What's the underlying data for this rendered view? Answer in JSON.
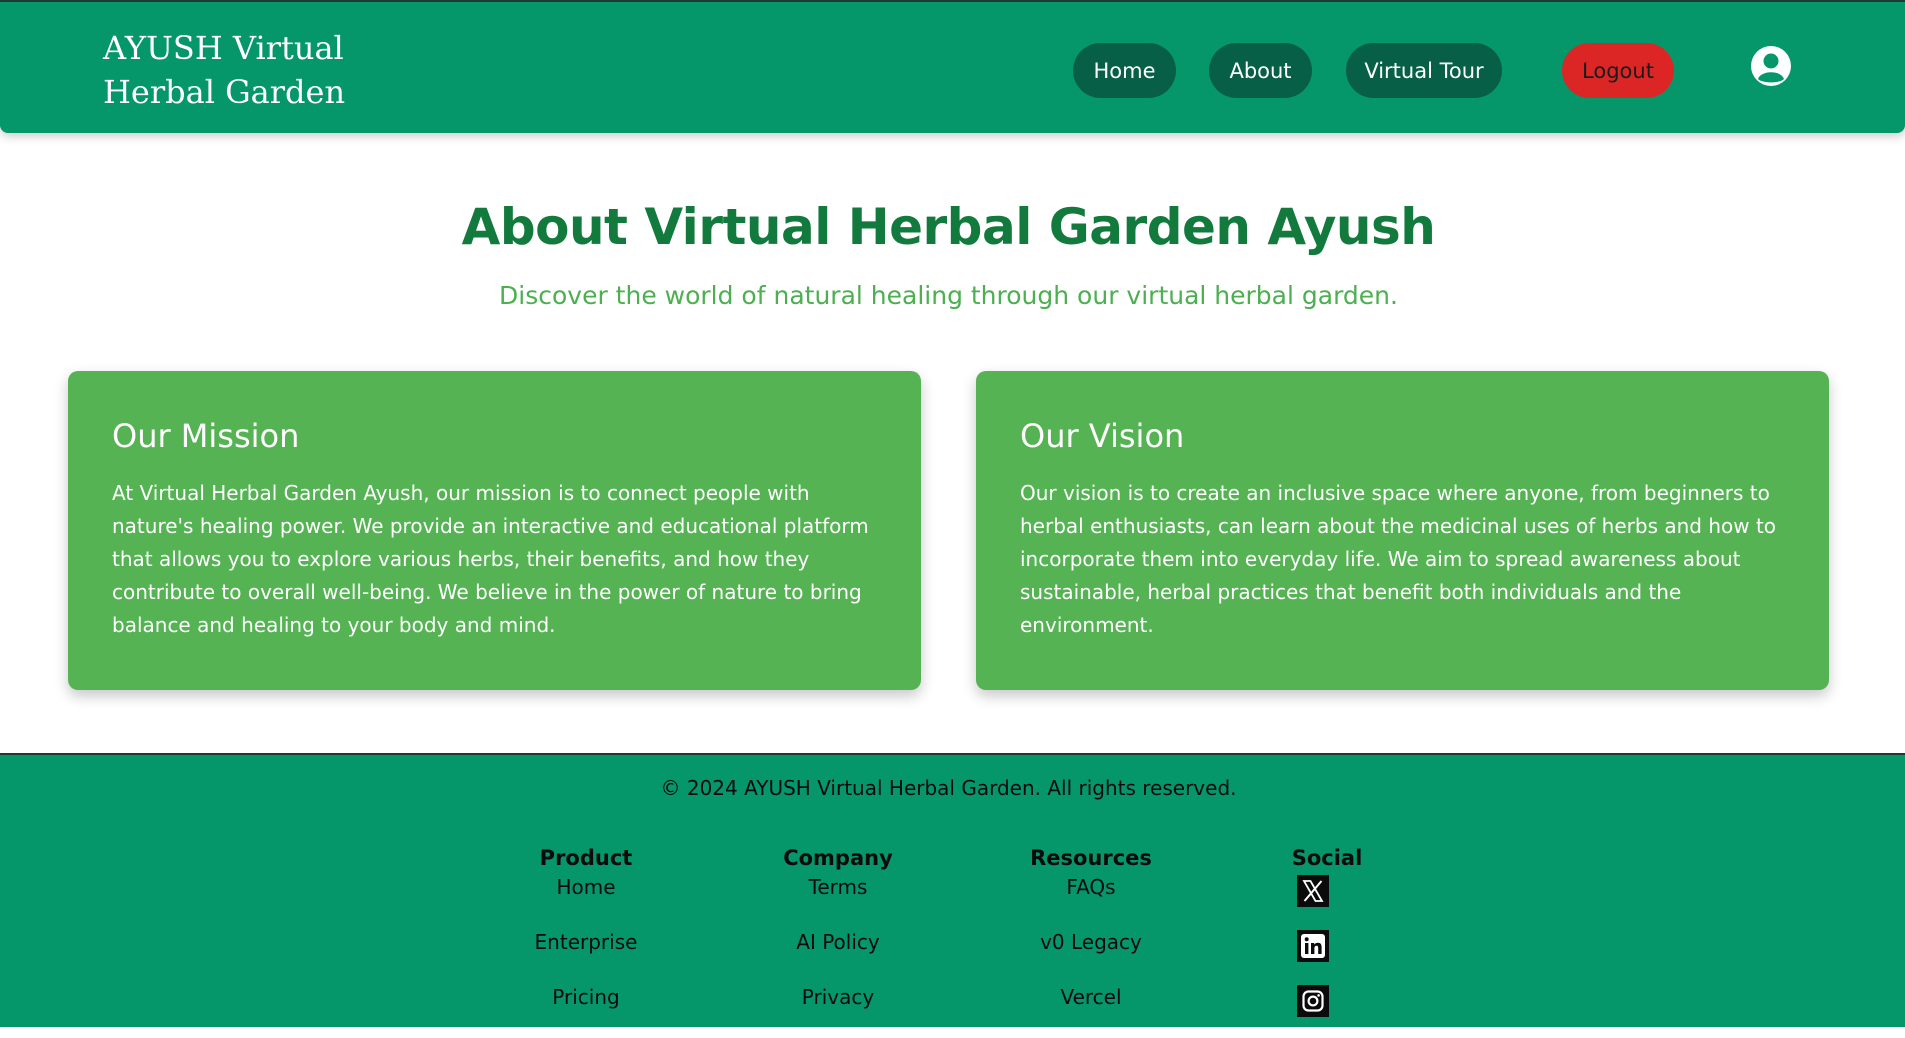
{
  "header": {
    "brand_line1": "AYUSH Virtual",
    "brand_line2": "Herbal Garden",
    "nav": {
      "home": "Home",
      "about": "About",
      "virtual_tour": "Virtual Tour",
      "logout": "Logout"
    },
    "profile_icon": "user-circle-icon"
  },
  "main": {
    "title": "About Virtual Herbal Garden Ayush",
    "subtitle": "Discover the world of natural healing through our virtual herbal garden.",
    "cards": [
      {
        "title": "Our Mission",
        "body": "At Virtual Herbal Garden Ayush, our mission is to connect people with nature's healing power. We provide an interactive and educational platform that allows you to explore various herbs, their benefits, and how they contribute to overall well-being. We believe in the power of nature to bring balance and healing to your body and mind."
      },
      {
        "title": "Our Vision",
        "body": "Our vision is to create an inclusive space where anyone, from beginners to herbal enthusiasts, can learn about the medicinal uses of herbs and how to incorporate them into everyday life. We aim to spread awareness about sustainable, herbal practices that benefit both individuals and the environment."
      }
    ]
  },
  "footer": {
    "copyright": "© 2024 AYUSH Virtual Herbal Garden. All rights reserved.",
    "columns": [
      {
        "heading": "Product",
        "links": [
          "Home",
          "Enterprise",
          "Pricing"
        ]
      },
      {
        "heading": "Company",
        "links": [
          "Terms",
          "AI Policy",
          "Privacy"
        ]
      },
      {
        "heading": "Resources",
        "links": [
          "FAQs",
          "v0 Legacy",
          "Vercel"
        ]
      }
    ],
    "social": {
      "heading": "Social",
      "icons": [
        "x-twitter-icon",
        "linkedin-icon",
        "instagram-icon"
      ]
    }
  },
  "colors": {
    "header_bg": "#05966a",
    "nav_button_bg": "#065f46",
    "logout_bg": "#dc2626",
    "title": "#127a3c",
    "subtitle": "#4caf50",
    "card_bg": "#55b354"
  }
}
